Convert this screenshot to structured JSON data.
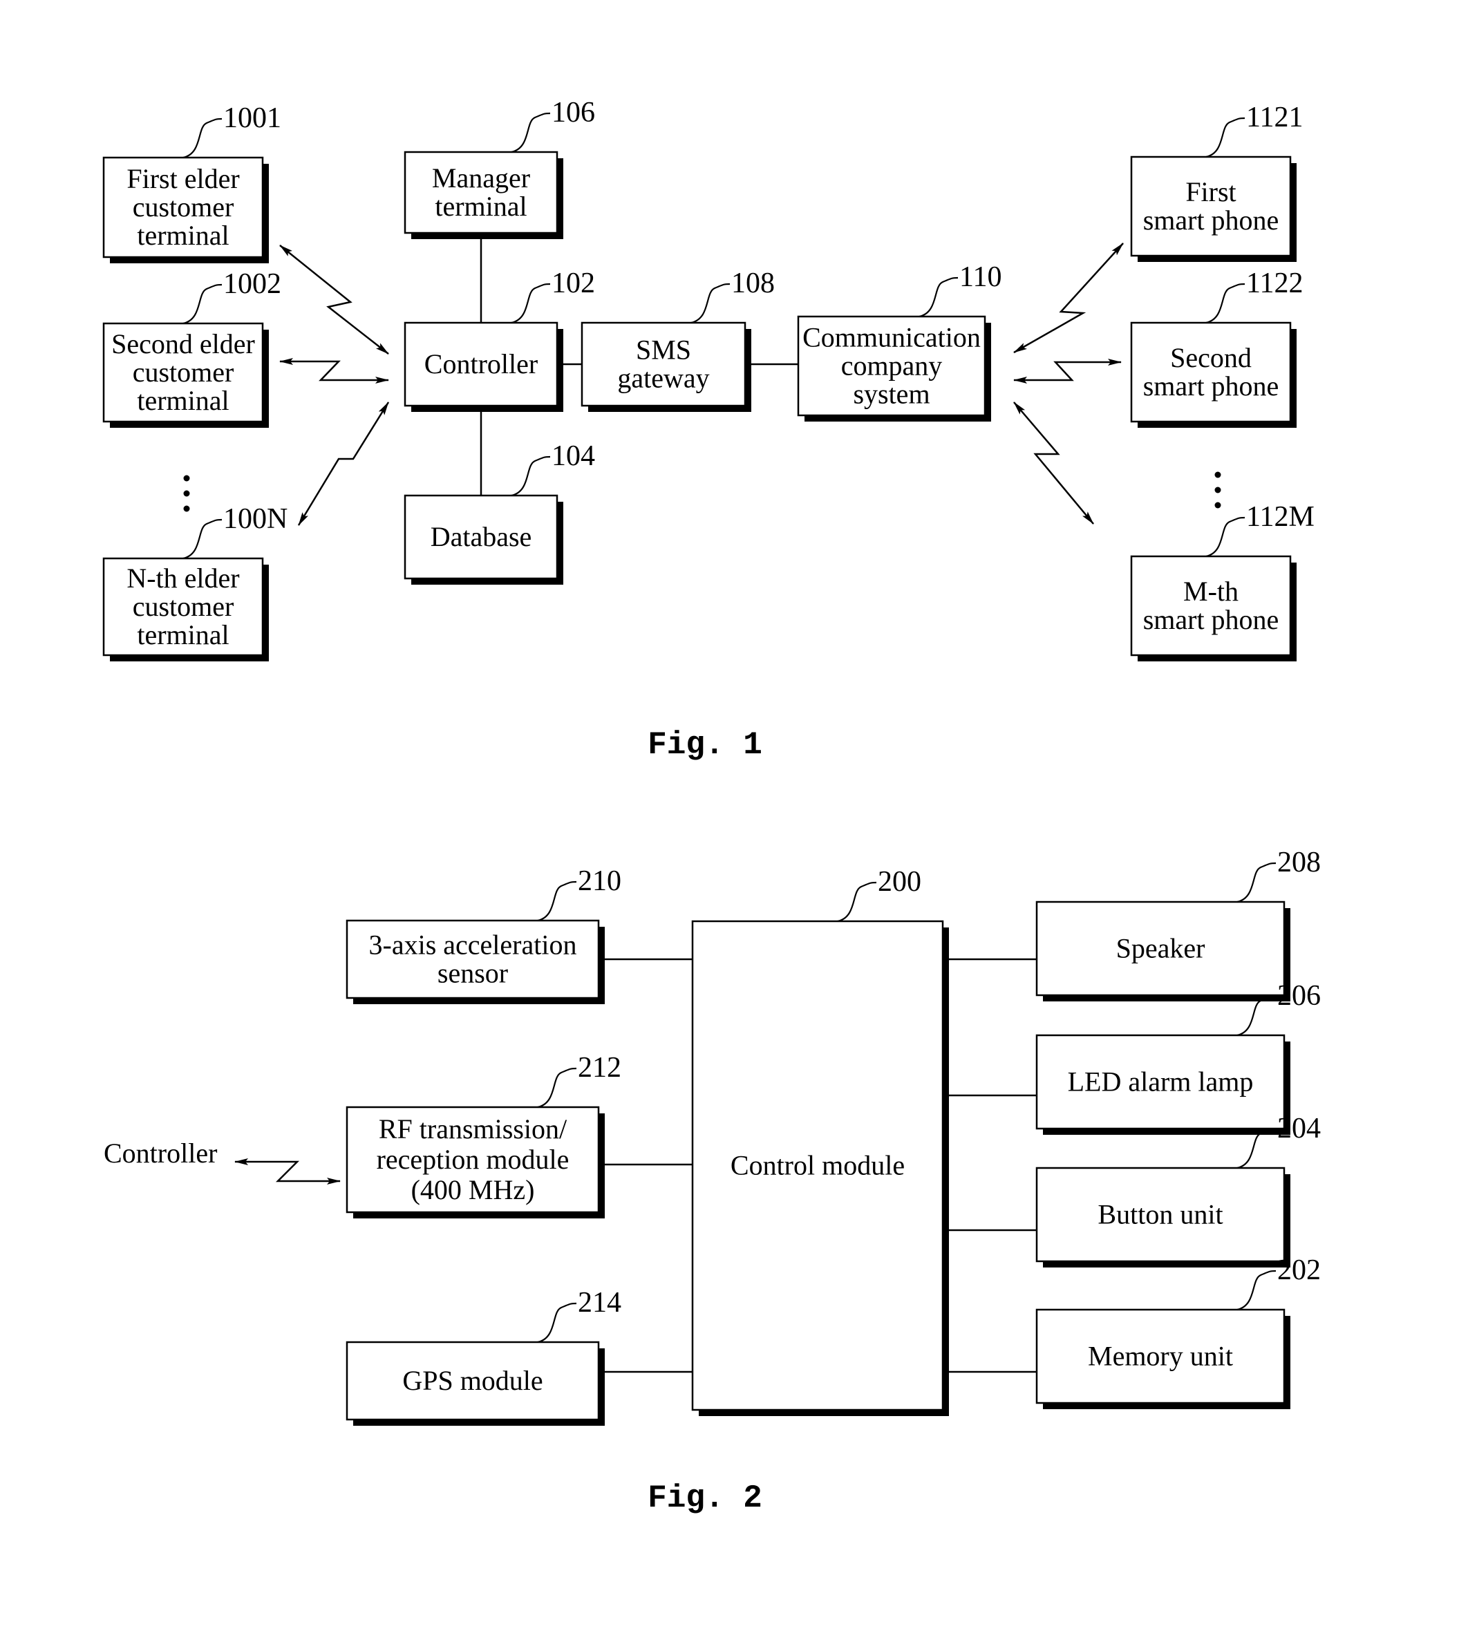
{
  "figures": {
    "fig1": {
      "caption": "Fig. 1",
      "blocks": {
        "elder1": {
          "ref": "1001",
          "lines": [
            "First elder",
            "customer",
            "terminal"
          ]
        },
        "elder2": {
          "ref": "1002",
          "lines": [
            "Second elder",
            "customer",
            "terminal"
          ]
        },
        "elderN": {
          "ref": "100N",
          "lines": [
            "N-th elder",
            "customer",
            "terminal"
          ]
        },
        "manager": {
          "ref": "106",
          "lines": [
            "Manager",
            "terminal"
          ]
        },
        "controller": {
          "ref": "102",
          "lines": [
            "Controller"
          ]
        },
        "database": {
          "ref": "104",
          "lines": [
            "Database"
          ]
        },
        "sms": {
          "ref": "108",
          "lines": [
            "SMS",
            "gateway"
          ]
        },
        "comm": {
          "ref": "110",
          "lines": [
            "Communication",
            "company",
            "system"
          ]
        },
        "phone1": {
          "ref": "1121",
          "lines": [
            "First",
            "smart phone"
          ]
        },
        "phone2": {
          "ref": "1122",
          "lines": [
            "Second",
            "smart phone"
          ]
        },
        "phoneM": {
          "ref": "112M",
          "lines": [
            "M-th",
            "smart phone"
          ]
        }
      }
    },
    "fig2": {
      "caption": "Fig. 2",
      "external_label": "Controller",
      "blocks": {
        "accel": {
          "ref": "210",
          "lines": [
            "3-axis acceleration",
            "sensor"
          ]
        },
        "rf": {
          "ref": "212",
          "lines": [
            "RF transmission/",
            "reception module",
            "(400 MHz)"
          ]
        },
        "gps": {
          "ref": "214",
          "lines": [
            "GPS module"
          ]
        },
        "control": {
          "ref": "200",
          "lines": [
            "Control module"
          ]
        },
        "speaker": {
          "ref": "208",
          "lines": [
            "Speaker"
          ]
        },
        "led": {
          "ref": "206",
          "lines": [
            "LED alarm lamp"
          ]
        },
        "button": {
          "ref": "204",
          "lines": [
            "Button unit"
          ]
        },
        "memory": {
          "ref": "202",
          "lines": [
            "Memory unit"
          ]
        }
      }
    }
  }
}
